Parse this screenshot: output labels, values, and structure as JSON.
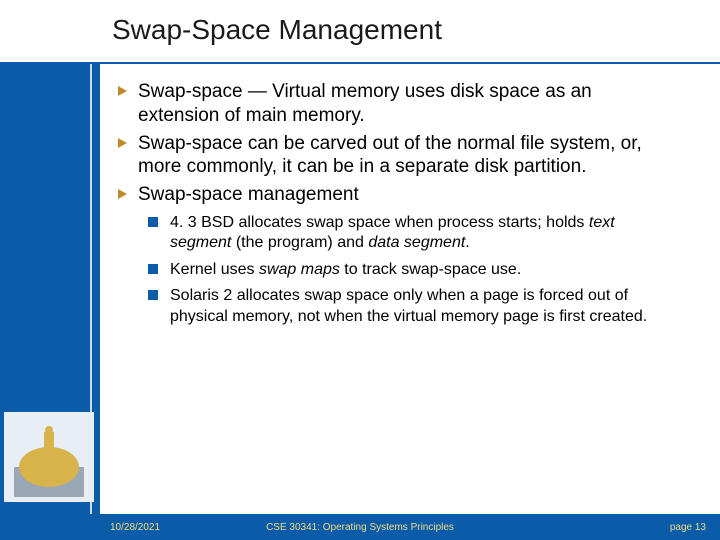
{
  "title": "Swap-Space Management",
  "bullets": [
    {
      "text": "Swap-space — Virtual memory uses disk space as an extension of main memory."
    },
    {
      "text": "Swap-space can be carved out of the normal file system, or, more commonly, it can be in a separate disk partition."
    },
    {
      "text": "Swap-space management"
    }
  ],
  "sub": {
    "b0": {
      "pre": "4. 3 BSD allocates swap space when process starts; holds ",
      "i1": "text segment",
      "mid": " (the program) and ",
      "i2": "data segment",
      "post": "."
    },
    "b1": {
      "pre": "Kernel uses ",
      "i1": "swap maps",
      "post": " to track swap-space use."
    },
    "b2": {
      "text": "Solaris 2 allocates swap space only when a page is forced out of physical memory, not when the virtual memory page is first created."
    }
  },
  "footer": {
    "date": "10/28/2021",
    "course": "CSE 30341: Operating Systems Principles",
    "page": "page 13"
  }
}
